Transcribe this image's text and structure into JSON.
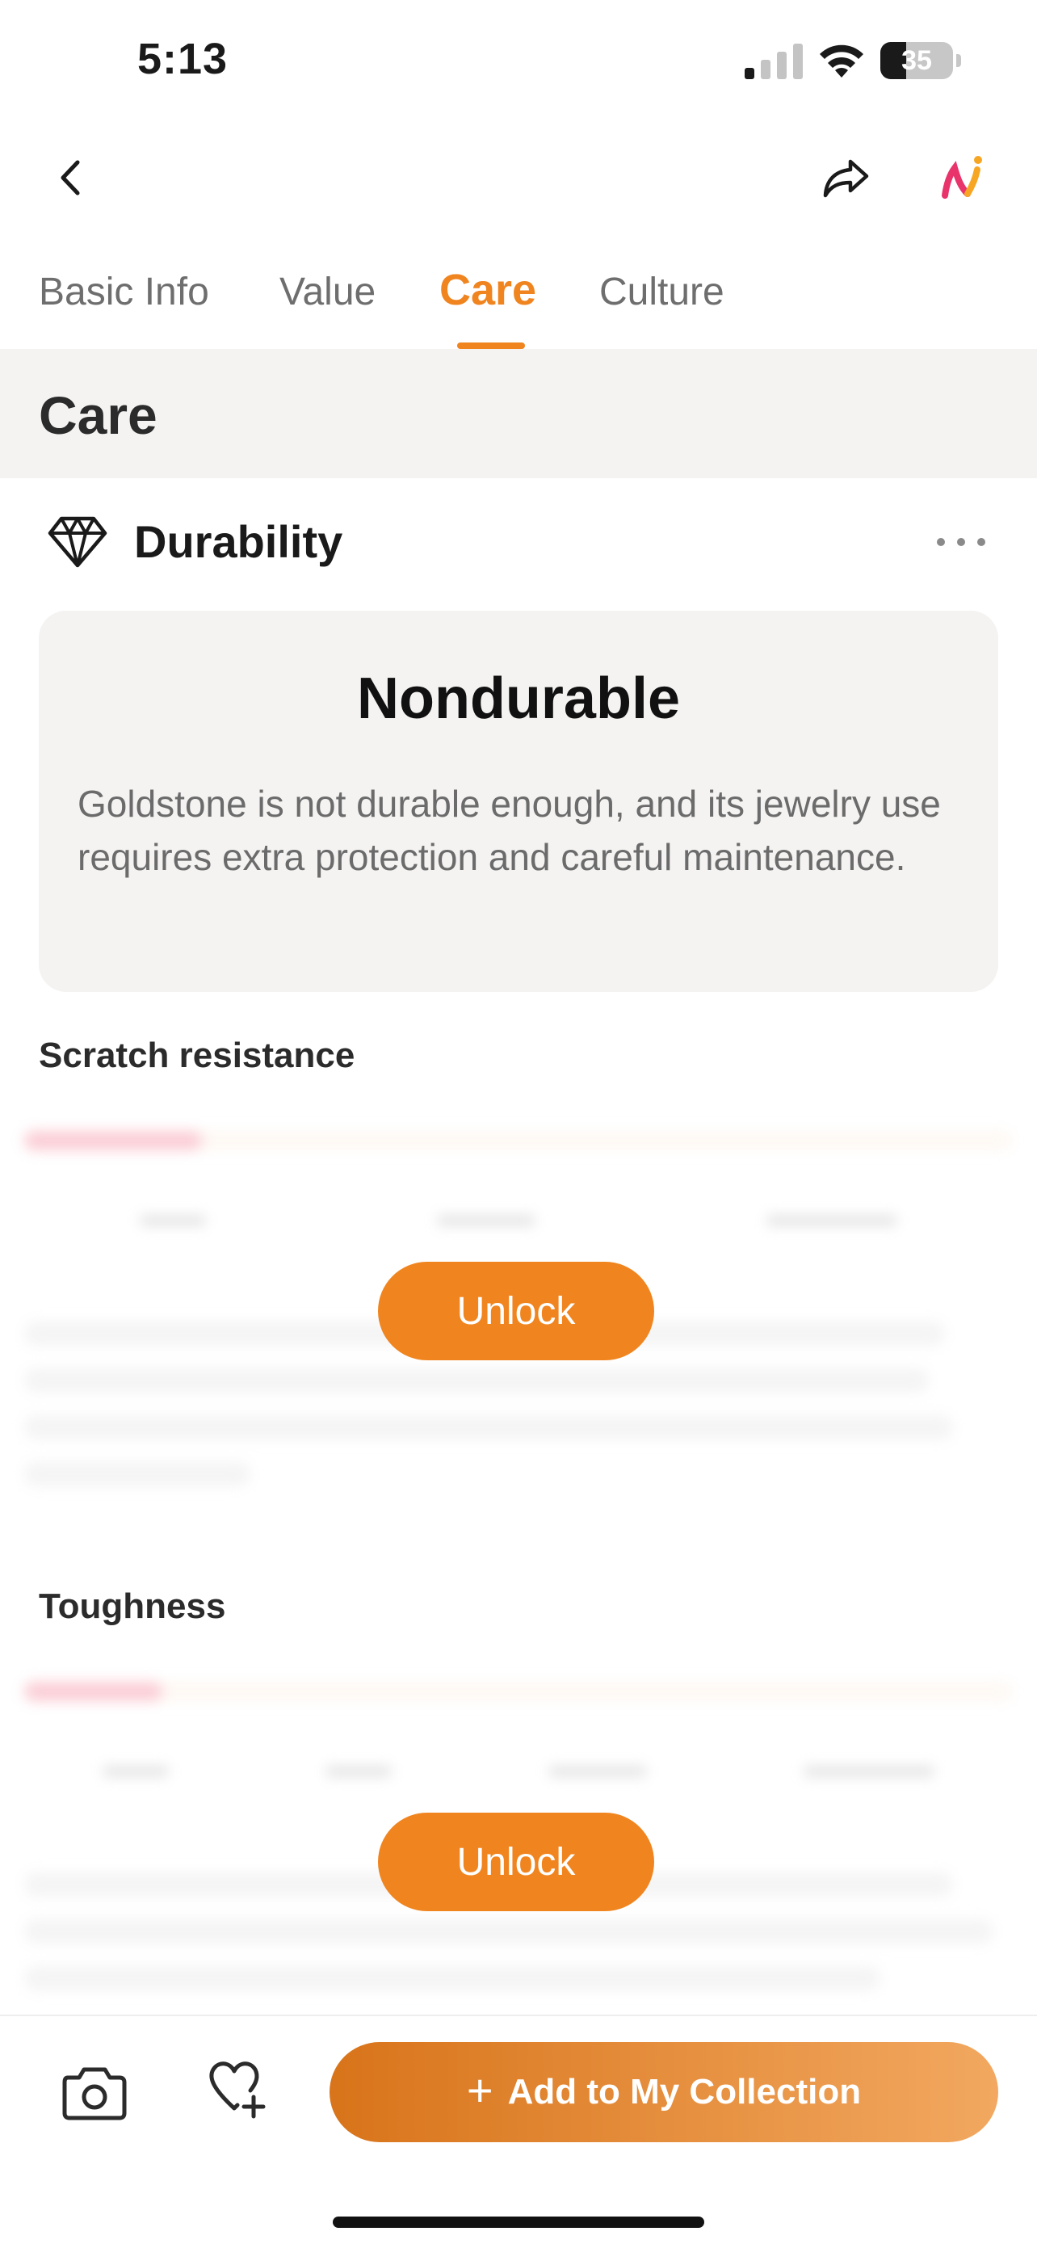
{
  "status_bar": {
    "time": "5:13",
    "battery": "35",
    "battery_level": 0.35
  },
  "nav": {
    "back_icon": "chevron-left-icon",
    "share_icon": "share-icon",
    "ai_icon": "ai-logo-icon"
  },
  "tabs": [
    {
      "label": "Basic Info",
      "active": false
    },
    {
      "label": "Value",
      "active": false
    },
    {
      "label": "Care",
      "active": true
    },
    {
      "label": "Culture",
      "active": false
    }
  ],
  "section": {
    "title": "Care"
  },
  "durability": {
    "title": "Durability",
    "icon": "diamond-icon",
    "rating": "Nondurable",
    "description": "Goldstone is not durable enough, and its jewelry use requires extra protection and careful maintenance."
  },
  "scratch_resistance": {
    "title": "Scratch resistance",
    "unlock_label": "Unlock",
    "level": 0.18
  },
  "toughness": {
    "title": "Toughness",
    "unlock_label": "Unlock",
    "level": 0.14
  },
  "bottom_bar": {
    "camera_icon": "camera-icon",
    "favorite_icon": "heart-plus-icon",
    "add_label": "Add to My Collection",
    "add_symbol": "+"
  },
  "colors": {
    "accent": "#f0841f",
    "card_bg": "#f4f3f2",
    "ai_pink": "#e8336b",
    "ai_orange": "#f6a623"
  }
}
